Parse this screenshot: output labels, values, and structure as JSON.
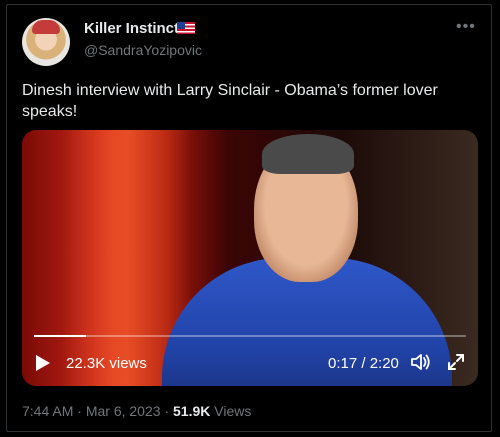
{
  "user": {
    "display_name": "Killer Instinct",
    "handle": "@SandraYozipovic",
    "badge_icon": "us-flag-icon",
    "more_icon": "more-icon"
  },
  "tweet": {
    "text": "Dinesh interview with Larry Sinclair - Obama’s former lover speaks!"
  },
  "video": {
    "views_label": "22.3K views",
    "time_label": "0:17 / 2:20",
    "progress_fraction": 0.121,
    "controls": [
      "play-icon",
      "volume-icon",
      "fullscreen-icon"
    ]
  },
  "meta": {
    "time": "7:44 AM",
    "separator": "·",
    "date": "Mar 6, 2023",
    "views_count": "51.9K",
    "views_word": "Views"
  },
  "colors": {
    "background": "#000000",
    "text": "#e7e9ea",
    "muted": "#71767b",
    "border": "#2f3336"
  }
}
